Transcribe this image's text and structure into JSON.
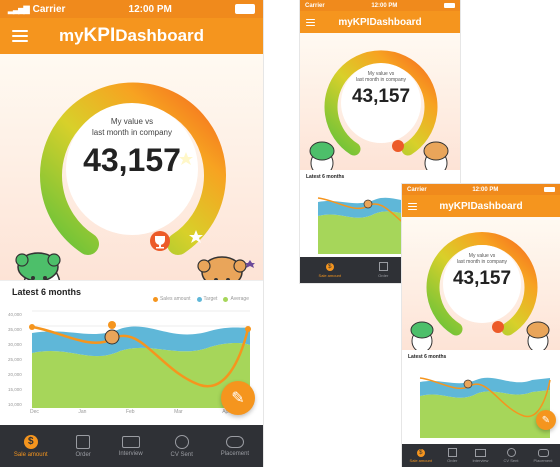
{
  "status": {
    "carrier": "Carrier",
    "time": "12:00 PM",
    "time_small": "12:00 PM"
  },
  "app": {
    "title_prefix": "my",
    "title_kpi": "KPI",
    "title_suffix": " Dashboard"
  },
  "gauge": {
    "caption_line1": "My value vs",
    "caption_line2": "last month in company",
    "value": "43,157"
  },
  "chart": {
    "title": "Latest 6 months",
    "legend": [
      "Sales amount",
      "Target",
      "Average"
    ],
    "y_ticks": [
      "40,000",
      "35,000",
      "30,000",
      "25,000",
      "20,000",
      "15,000",
      "10,000",
      "5,000"
    ],
    "x_ticks": [
      "Dec",
      "Jan",
      "Feb",
      "Mar",
      "Apr",
      "May"
    ]
  },
  "tabs": [
    {
      "label": "Sale amount",
      "icon": "dollar-icon"
    },
    {
      "label": "Order",
      "icon": "order-icon"
    },
    {
      "label": "Interview",
      "icon": "interview-icon"
    },
    {
      "label": "CV Sent",
      "icon": "cv-icon"
    },
    {
      "label": "Placement",
      "icon": "placement-icon"
    }
  ],
  "colors": {
    "orange": "#f5951e",
    "tabbar": "#2f3136",
    "blue": "#5fb7d8",
    "green": "#a6d65a"
  }
}
